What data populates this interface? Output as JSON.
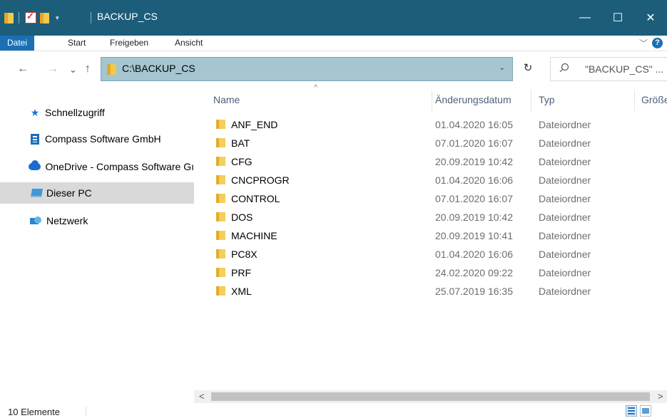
{
  "window": {
    "title": "BACKUP_CS",
    "minimize": "—",
    "maximize": "☐",
    "close": "✕"
  },
  "ribbon": {
    "tabs": [
      "Datei",
      "Start",
      "Freigeben",
      "Ansicht"
    ],
    "expand": "﹀",
    "help": "?"
  },
  "nav": {
    "back": "←",
    "forward": "→",
    "recent": "⌄",
    "up": "↑",
    "address": "C:\\BACKUP_CS",
    "address_dropdown": "⌄",
    "refresh": "↻",
    "search_placeholder": "\"BACKUP_CS\" ...",
    "search_icon": "⚲"
  },
  "sidebar": {
    "items": [
      {
        "label": "Schnellzugriff",
        "icon": "star-icon"
      },
      {
        "label": "Compass Software GmbH",
        "icon": "building-icon"
      },
      {
        "label": "OneDrive - Compass Software Gı",
        "icon": "cloud-icon"
      },
      {
        "label": "Dieser PC",
        "icon": "pc-icon",
        "selected": true
      },
      {
        "label": "Netzwerk",
        "icon": "network-icon"
      }
    ]
  },
  "columns": {
    "name": "Name",
    "date": "Änderungsdatum",
    "type": "Typ",
    "size": "Größe",
    "sort_indicator": "^"
  },
  "files": [
    {
      "name": "ANF_END",
      "date": "01.04.2020 16:05",
      "type": "Dateiordner"
    },
    {
      "name": "BAT",
      "date": "07.01.2020 16:07",
      "type": "Dateiordner"
    },
    {
      "name": "CFG",
      "date": "20.09.2019 10:42",
      "type": "Dateiordner"
    },
    {
      "name": "CNCPROGR",
      "date": "01.04.2020 16:06",
      "type": "Dateiordner"
    },
    {
      "name": "CONTROL",
      "date": "07.01.2020 16:07",
      "type": "Dateiordner"
    },
    {
      "name": "DOS",
      "date": "20.09.2019 10:42",
      "type": "Dateiordner"
    },
    {
      "name": "MACHINE",
      "date": "20.09.2019 10:41",
      "type": "Dateiordner"
    },
    {
      "name": "PC8X",
      "date": "01.04.2020 16:06",
      "type": "Dateiordner"
    },
    {
      "name": "PRF",
      "date": "24.02.2020 09:22",
      "type": "Dateiordner"
    },
    {
      "name": "XML",
      "date": "25.07.2019 16:35",
      "type": "Dateiordner"
    }
  ],
  "scroll": {
    "left": "<",
    "right": ">"
  },
  "status": {
    "count": "10 Elemente"
  },
  "colors": {
    "titlebar": "#1c5d7a",
    "accent": "#1a6fb5",
    "address_bg": "#a5c5d1",
    "selected": "#d9d9d9"
  }
}
